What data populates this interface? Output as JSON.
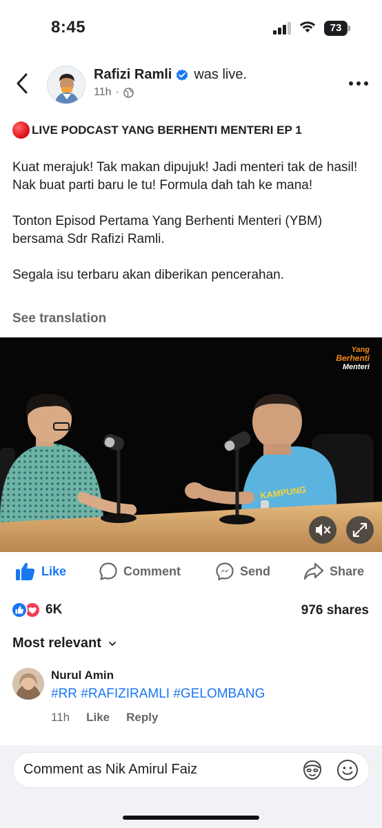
{
  "status_bar": {
    "time": "8:45",
    "battery": "73"
  },
  "post": {
    "author": "Rafizi Ramli",
    "status": "was live.",
    "time": "11h",
    "separator": "·",
    "title": "LIVE PODCAST YANG BERHENTI MENTERI EP 1",
    "body": [
      "Kuat merajuk! Tak makan dipujuk! Jadi menteri tak de hasil! Nak buat parti baru le tu! Formula dah tah ke mana!",
      "Tonton Episod Pertama Yang Berhenti Menteri (YBM) bersama Sdr Rafizi Ramli.",
      "Segala isu terbaru akan diberikan pencerahan."
    ],
    "see_translation": "See translation",
    "video": {
      "logo_line1": "Yang",
      "logo_line2": "Berhenti",
      "logo_line3": "Menteri",
      "shirt_text": "KAMPUNG"
    }
  },
  "actions": {
    "like": "Like",
    "comment": "Comment",
    "send": "Send",
    "share": "Share"
  },
  "stats": {
    "reactions": "6K",
    "shares": "976 shares"
  },
  "comments_sort": "Most relevant",
  "comments": [
    {
      "author": "Nurul Amin",
      "text": "#RR #RAFIZIRAMLI #GELOMBANG",
      "time": "11h",
      "like": "Like",
      "reply": "Reply"
    }
  ],
  "composer": {
    "placeholder": "Comment as Nik Amirul Faiz"
  },
  "colors": {
    "accent": "#1877f2",
    "muted": "#65676b",
    "love": "#f33e58",
    "live": "#e0141e"
  },
  "icons": [
    "back-arrow-icon",
    "verified-badge-icon",
    "globe-icon",
    "more-icon",
    "mute-icon",
    "fullscreen-icon",
    "like-icon",
    "comment-icon",
    "messenger-icon",
    "share-icon",
    "chevron-down-icon",
    "avatar-sticker-icon",
    "emoji-icon"
  ]
}
